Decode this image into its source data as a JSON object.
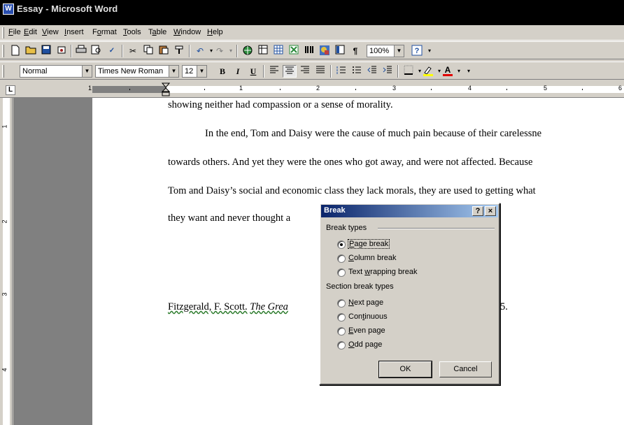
{
  "window": {
    "title": "Essay - Microsoft Word",
    "app_icon": "W"
  },
  "menu": [
    {
      "pre": "",
      "key": "F",
      "post": "ile"
    },
    {
      "pre": "",
      "key": "E",
      "post": "dit"
    },
    {
      "pre": "",
      "key": "V",
      "post": "iew"
    },
    {
      "pre": "",
      "key": "I",
      "post": "nsert"
    },
    {
      "pre": "F",
      "key": "o",
      "post": "rmat"
    },
    {
      "pre": "",
      "key": "T",
      "post": "ools"
    },
    {
      "pre": "T",
      "key": "a",
      "post": "ble"
    },
    {
      "pre": "",
      "key": "W",
      "post": "indow"
    },
    {
      "pre": "",
      "key": "H",
      "post": "elp"
    }
  ],
  "standard_toolbar": {
    "zoom": "100%",
    "paragraph_mark": "¶"
  },
  "formatting_toolbar": {
    "style": "Normal",
    "font": "Times New Roman",
    "size": "12",
    "bold": "B",
    "italic": "I",
    "underline": "U"
  },
  "ruler": {
    "numbers": [
      "1",
      "1",
      "2",
      "3",
      "4",
      "5",
      "6"
    ]
  },
  "vruler": {
    "numbers": [
      "1",
      "2",
      "3",
      "4"
    ]
  },
  "document": {
    "lines": [
      "showing neither had compassion or a sense of morality.",
      "In the end, Tom and Daisy were the cause of much pain because of their carelessne",
      "towards others. And yet they were the ones who got away, and were not affected. Because",
      "Tom and Daisy’s social and economic class they lack morals, they are used to getting what",
      "they want and never thought a"
    ],
    "citation": {
      "author": "Fitzgerald, F. Scott.",
      "title": "The Grea",
      "tail": "5."
    }
  },
  "dialog": {
    "title": "Break",
    "help": "?",
    "close": "×",
    "break_types_label": "Break types",
    "break_types": [
      {
        "pre": "",
        "key": "P",
        "post": "age break",
        "checked": true
      },
      {
        "pre": "",
        "key": "C",
        "post": "olumn break",
        "checked": false
      },
      {
        "pre": "Text ",
        "key": "w",
        "post": "rapping break",
        "checked": false
      }
    ],
    "section_label": "Section break types",
    "section_types": [
      {
        "pre": "",
        "key": "N",
        "post": "ext page",
        "checked": false
      },
      {
        "pre": "Con",
        "key": "t",
        "post": "inuous",
        "checked": false
      },
      {
        "pre": "",
        "key": "E",
        "post": "ven page",
        "checked": false
      },
      {
        "pre": "",
        "key": "O",
        "post": "dd page",
        "checked": false
      }
    ],
    "ok": "OK",
    "cancel": "Cancel"
  }
}
